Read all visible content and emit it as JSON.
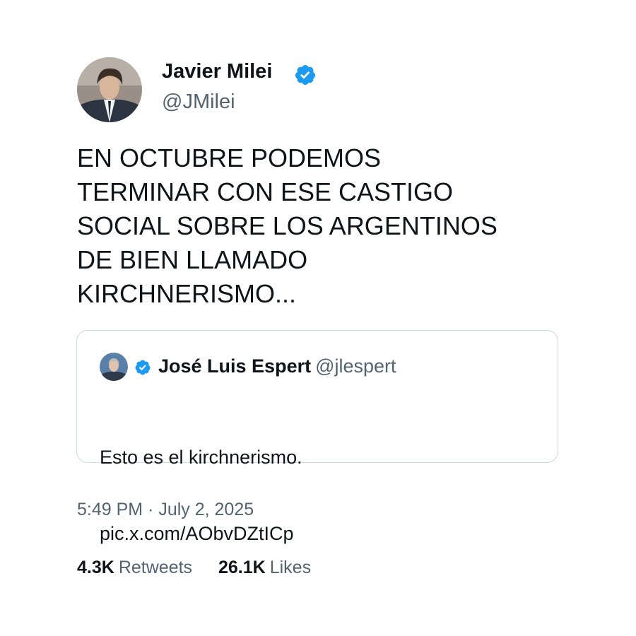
{
  "tweet": {
    "author": {
      "name": "Javier Milei",
      "handle": "@JMilei",
      "verified": true,
      "avatar_icon": "profile-photo"
    },
    "text": "EN OCTUBRE PODEMOS\nTERMINAR CON ESE CASTIGO\nSOCIAL SOBRE LOS ARGENTINOS\nDE BIEN LLAMADO\nKIRCHNERISMO...",
    "quoted": {
      "author_name": "José Luis Espert",
      "author_handle": "@jlespert",
      "verified": true,
      "text": "Esto es el kirchnerismo.",
      "link": "pic.x.com/AObvDZtICp"
    },
    "timestamp": "5:49 PM · July 2, 2025",
    "stats": {
      "retweets_count": "4.3K",
      "retweets_label": "Retweets",
      "likes_count": "26.1K",
      "likes_label": "Likes"
    }
  },
  "colors": {
    "text": "#0f1419",
    "secondary": "#536471",
    "verified": "#1d9bf0",
    "border": "#cfd9de",
    "background": "#ffffff"
  }
}
